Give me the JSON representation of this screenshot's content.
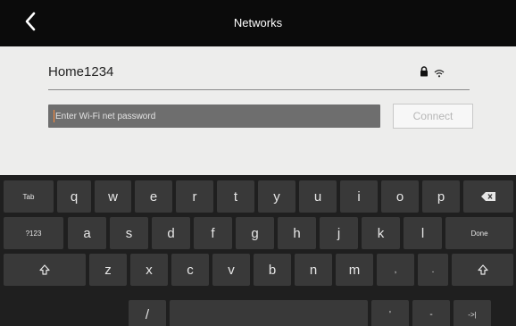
{
  "header": {
    "title": "Networks",
    "back_icon": "chevron-left-icon"
  },
  "network": {
    "ssid": "Home1234",
    "lock_icon": "lock-icon",
    "signal_icon": "wifi-icon"
  },
  "password": {
    "placeholder": "Enter Wi-Fi net password"
  },
  "connect_label": "Connect",
  "keyboard": {
    "row1": {
      "tab": "Tab",
      "keys": [
        "q",
        "w",
        "e",
        "r",
        "t",
        "y",
        "u",
        "i",
        "o",
        "p"
      ],
      "backspace_icon": "backspace-icon"
    },
    "row2": {
      "symbols": "?123",
      "keys": [
        "a",
        "s",
        "d",
        "f",
        "g",
        "h",
        "j",
        "k",
        "l"
      ],
      "done": "Done"
    },
    "row3": {
      "shift_icon": "shift-icon",
      "keys": [
        "z",
        "x",
        "c",
        "v",
        "b",
        "n",
        "m",
        ",",
        "."
      ]
    },
    "row4": {
      "slash": "/",
      "apostrophe": "'",
      "dash": "-",
      "tab_arrow": "->|"
    }
  },
  "colors": {
    "panel_bg": "#ededec",
    "titlebar_bg": "#0b0b0b",
    "keyboard_bg": "#1f1f1f",
    "key_bg": "#393939",
    "input_bg": "#6e6e6e"
  }
}
